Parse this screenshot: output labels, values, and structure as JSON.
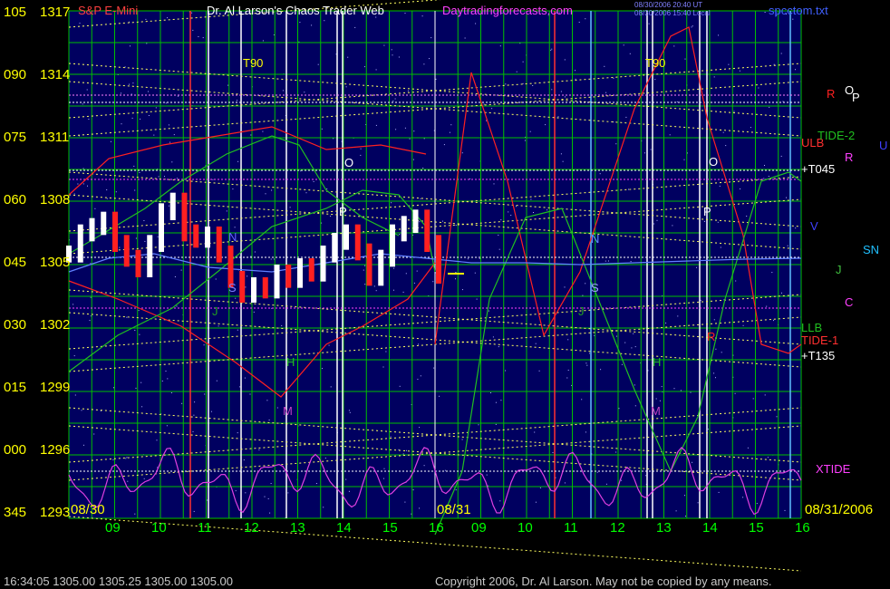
{
  "header": {
    "title_left": "S&P E-Mini",
    "title_center": "Dr. Al Larson's Chaos Trader Web",
    "title_site": "Daytradingforecasts.com",
    "stamp_line1": "08/30/2006 20:40 UT",
    "stamp_line2": "08/30/2006 15:40 Local",
    "file_name": "spcctom.txt"
  },
  "footer": {
    "time_quote": "16:34:05   1305.00 1305.25 1305.00 1305.00",
    "copyright": "Copyright 2006, Dr. Al Larson. May not be copied by any means."
  },
  "colors": {
    "background": "#000000",
    "plot_bg": "#000060",
    "grid": "#00c000",
    "price_bar": "#ffffff",
    "down_bar": "#ff2020",
    "ref_line": "#ffff60",
    "red_line": "#ff2020",
    "green_line": "#20c020",
    "magenta_line": "#e040e0"
  },
  "chart_data": {
    "type": "line",
    "title": "S&P E-Mini",
    "y_axis": {
      "degree_labels": [
        "105",
        "090",
        "075",
        "060",
        "045",
        "030",
        "015",
        "000",
        "345"
      ],
      "price_labels": [
        "1317",
        "1314",
        "1311",
        "1308",
        "1305",
        "1302",
        "1299",
        "1296",
        "1293"
      ],
      "price_range": [
        1293,
        1317
      ]
    },
    "x_axis": {
      "hour_labels": [
        "09",
        "10",
        "11",
        "12",
        "13",
        "14",
        "15",
        "16",
        "09",
        "10",
        "11",
        "12",
        "13",
        "14",
        "15",
        "16"
      ],
      "session_labels": [
        "08/30",
        "08/31",
        "08/31/2006"
      ]
    },
    "price_series": {
      "name": "S&P E-Mini",
      "hours": [
        8.0,
        8.25,
        8.5,
        8.75,
        9.0,
        9.25,
        9.5,
        9.75,
        10.0,
        10.25,
        10.5,
        10.75,
        11.0,
        11.25,
        11.5,
        11.75,
        12.0,
        12.25,
        12.5,
        12.75,
        13.0,
        13.25,
        13.5,
        13.75,
        14.0,
        14.25,
        14.5,
        14.75,
        15.0,
        15.25,
        15.5,
        15.75,
        16.0
      ],
      "close": [
        1305.5,
        1306.5,
        1306.8,
        1307.1,
        1306.0,
        1305.3,
        1304.8,
        1306.0,
        1307.5,
        1308.0,
        1306.5,
        1306.2,
        1306.4,
        1305.5,
        1304.3,
        1303.6,
        1304.0,
        1303.8,
        1304.6,
        1304.3,
        1304.9,
        1304.6,
        1305.5,
        1306.1,
        1306.5,
        1305.6,
        1304.4,
        1305.3,
        1306.5,
        1306.9,
        1307.2,
        1306.0,
        1304.5
      ],
      "last_price": 1305.0
    },
    "labels_on_chart": [
      "T90",
      "T90",
      "O",
      "P",
      "N",
      "S",
      "J",
      "H",
      "M",
      "O",
      "P",
      "N",
      "S",
      "J",
      "H",
      "M",
      "R",
      "R",
      "O",
      "P",
      "ULB",
      "TIDE-2",
      "TIDE-1",
      "LLB",
      "+T045",
      "+T135",
      "V",
      "SN",
      "J",
      "C",
      "R",
      "U",
      "XTIDE"
    ],
    "ylim": [
      1293,
      1317
    ],
    "grid": true
  }
}
